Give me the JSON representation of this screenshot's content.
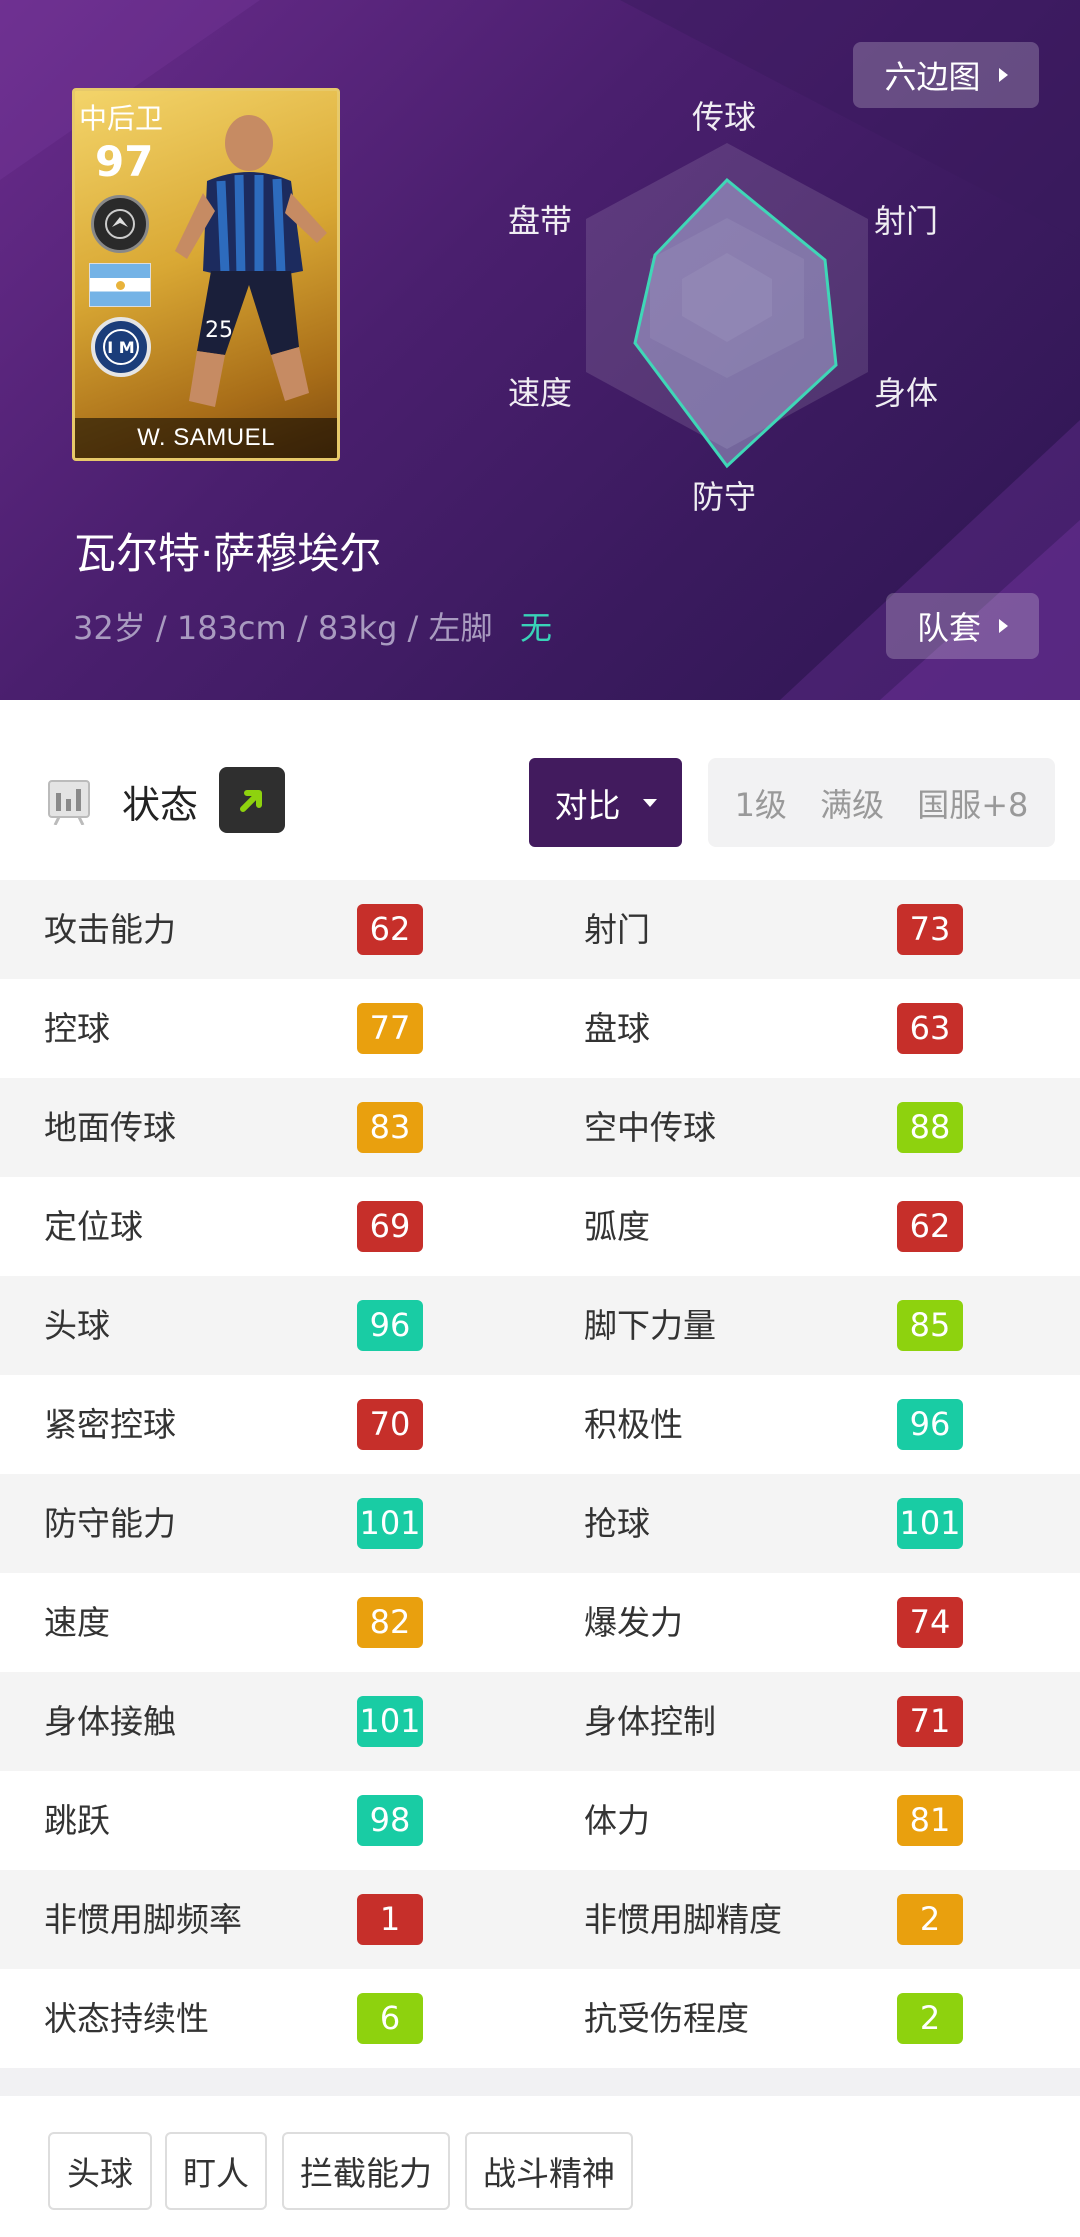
{
  "header": {
    "hexagon_button": "六边图",
    "kit_button": "队套",
    "card": {
      "position": "中后卫",
      "rating": "97",
      "name": "W. SAMUEL"
    },
    "player_name": "瓦尔特·萨穆埃尔",
    "player_info": "32岁 / 183cm / 83kg / 左脚",
    "player_extra": "无",
    "radar_labels": {
      "top": "传球",
      "upper_left": "盘带",
      "upper_right": "射门",
      "lower_left": "速度",
      "lower_right": "身体",
      "bottom": "防守"
    }
  },
  "status": {
    "label": "状态",
    "compare_label": "对比",
    "levels": [
      "1级",
      "满级",
      "国服+8"
    ]
  },
  "colors": {
    "red": "#c62f2a",
    "orange": "#e9a00e",
    "lime": "#8ed20e",
    "teal": "#19cca4",
    "header_purple": "#4a1f6e",
    "compare_purple": "#421b5e"
  },
  "stats": [
    {
      "left": {
        "name": "攻击能力",
        "value": "62",
        "tier": "red"
      },
      "right": {
        "name": "射门",
        "value": "73",
        "tier": "red"
      }
    },
    {
      "left": {
        "name": "控球",
        "value": "77",
        "tier": "orange"
      },
      "right": {
        "name": "盘球",
        "value": "63",
        "tier": "red"
      }
    },
    {
      "left": {
        "name": "地面传球",
        "value": "83",
        "tier": "orange"
      },
      "right": {
        "name": "空中传球",
        "value": "88",
        "tier": "lime"
      }
    },
    {
      "left": {
        "name": "定位球",
        "value": "69",
        "tier": "red"
      },
      "right": {
        "name": "弧度",
        "value": "62",
        "tier": "red"
      }
    },
    {
      "left": {
        "name": "头球",
        "value": "96",
        "tier": "teal"
      },
      "right": {
        "name": "脚下力量",
        "value": "85",
        "tier": "lime"
      }
    },
    {
      "left": {
        "name": "紧密控球",
        "value": "70",
        "tier": "red"
      },
      "right": {
        "name": "积极性",
        "value": "96",
        "tier": "teal"
      }
    },
    {
      "left": {
        "name": "防守能力",
        "value": "101",
        "tier": "teal"
      },
      "right": {
        "name": "抢球",
        "value": "101",
        "tier": "teal"
      }
    },
    {
      "left": {
        "name": "速度",
        "value": "82",
        "tier": "orange"
      },
      "right": {
        "name": "爆发力",
        "value": "74",
        "tier": "red"
      }
    },
    {
      "left": {
        "name": "身体接触",
        "value": "101",
        "tier": "teal"
      },
      "right": {
        "name": "身体控制",
        "value": "71",
        "tier": "red"
      }
    },
    {
      "left": {
        "name": "跳跃",
        "value": "98",
        "tier": "teal"
      },
      "right": {
        "name": "体力",
        "value": "81",
        "tier": "orange"
      }
    },
    {
      "left": {
        "name": "非惯用脚频率",
        "value": "1",
        "tier": "red"
      },
      "right": {
        "name": "非惯用脚精度",
        "value": "2",
        "tier": "orange"
      }
    },
    {
      "left": {
        "name": "状态持续性",
        "value": "6",
        "tier": "lime"
      },
      "right": {
        "name": "抗受伤程度",
        "value": "2",
        "tier": "lime"
      }
    }
  ],
  "skills": [
    "头球",
    "盯人",
    "拦截能力",
    "战斗精神"
  ],
  "icons": {
    "status": "status-chart-icon",
    "arrow": "arrow-up-right-icon",
    "hex_chevron": "chevron-right-icon",
    "compare_caret": "caret-down-icon"
  }
}
